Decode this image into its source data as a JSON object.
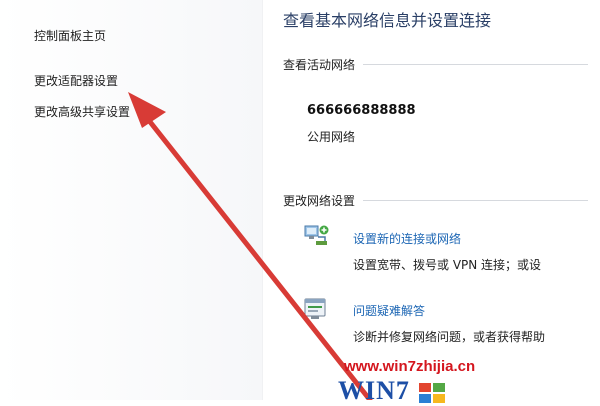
{
  "sidebar": {
    "items": [
      {
        "label": "控制面板主页"
      },
      {
        "label": "更改适配器设置"
      },
      {
        "label": "更改高级共享设置"
      }
    ]
  },
  "header": {
    "title": "查看基本网络信息并设置连接"
  },
  "active_networks": {
    "heading": "查看活动网络",
    "network_name": "666666888888",
    "network_type": "公用网络"
  },
  "change_settings": {
    "heading": "更改网络设置",
    "tasks": [
      {
        "icon": "network-connection-icon",
        "link": "设置新的连接或网络",
        "description": "设置宽带、拨号或 VPN 连接；或设"
      },
      {
        "icon": "troubleshoot-icon",
        "link": "问题疑难解答",
        "description": "诊断并修复网络问题，或者获得帮助"
      }
    ]
  },
  "watermark": {
    "url": "www.win7zhijia.cn",
    "logo": "WIN7"
  },
  "colors": {
    "link": "#1c66b4",
    "title": "#2a3f66",
    "annotation_arrow": "#d83b36",
    "watermark_red": "#d4161e",
    "watermark_blue": "#1d4fa6"
  }
}
